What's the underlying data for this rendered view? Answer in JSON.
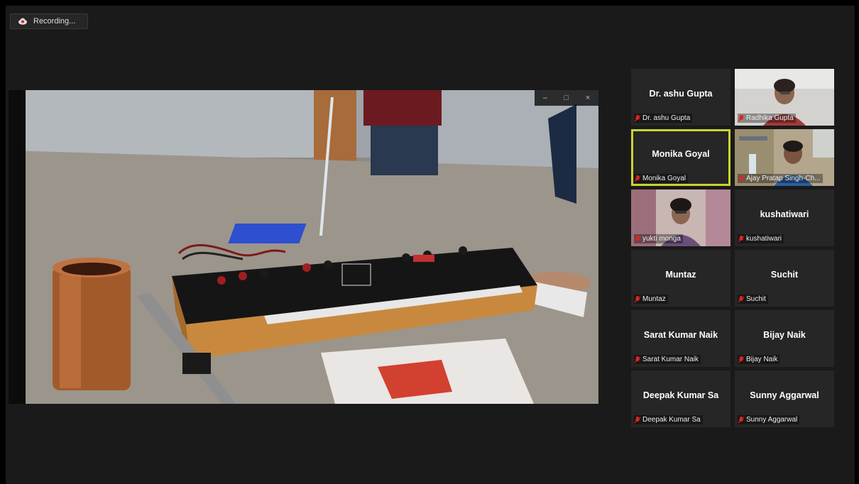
{
  "recording": {
    "label": "Recording..."
  },
  "share_window": {
    "min": "–",
    "max": "□",
    "close": "×"
  },
  "participants": [
    {
      "name": "Dr. ashu Gupta",
      "show_name": true,
      "video": false,
      "muted": true,
      "active": false
    },
    {
      "name": "Radhika Gupta",
      "show_name": false,
      "video": true,
      "muted": true,
      "active": false
    },
    {
      "name": "Monika Goyal",
      "show_name": true,
      "video": false,
      "muted": true,
      "active": true
    },
    {
      "name": "Ajay Pratap Singh-Ch...",
      "show_name": false,
      "video": true,
      "muted": true,
      "active": false
    },
    {
      "name": "yukti monga",
      "show_name": false,
      "video": true,
      "muted": true,
      "active": false
    },
    {
      "name": "kushatiwari",
      "show_name": true,
      "video": false,
      "muted": true,
      "active": false
    },
    {
      "name": "Muntaz",
      "show_name": true,
      "video": false,
      "muted": true,
      "active": false
    },
    {
      "name": "Suchit",
      "show_name": true,
      "video": false,
      "muted": true,
      "active": false
    },
    {
      "name": "Sarat Kumar Naik",
      "show_name": true,
      "video": false,
      "muted": true,
      "active": false
    },
    {
      "name": "Bijay Naik",
      "show_name": true,
      "video": false,
      "muted": true,
      "active": false
    },
    {
      "name": "Deepak Kumar Sa",
      "show_name": true,
      "video": false,
      "muted": true,
      "active": false
    },
    {
      "name": "Sunny Aggarwal",
      "show_name": true,
      "video": false,
      "muted": true,
      "active": false
    }
  ],
  "colors": {
    "active_border": "#c8d430",
    "muted_icon": "#e02424",
    "tile_bg": "#262626"
  }
}
